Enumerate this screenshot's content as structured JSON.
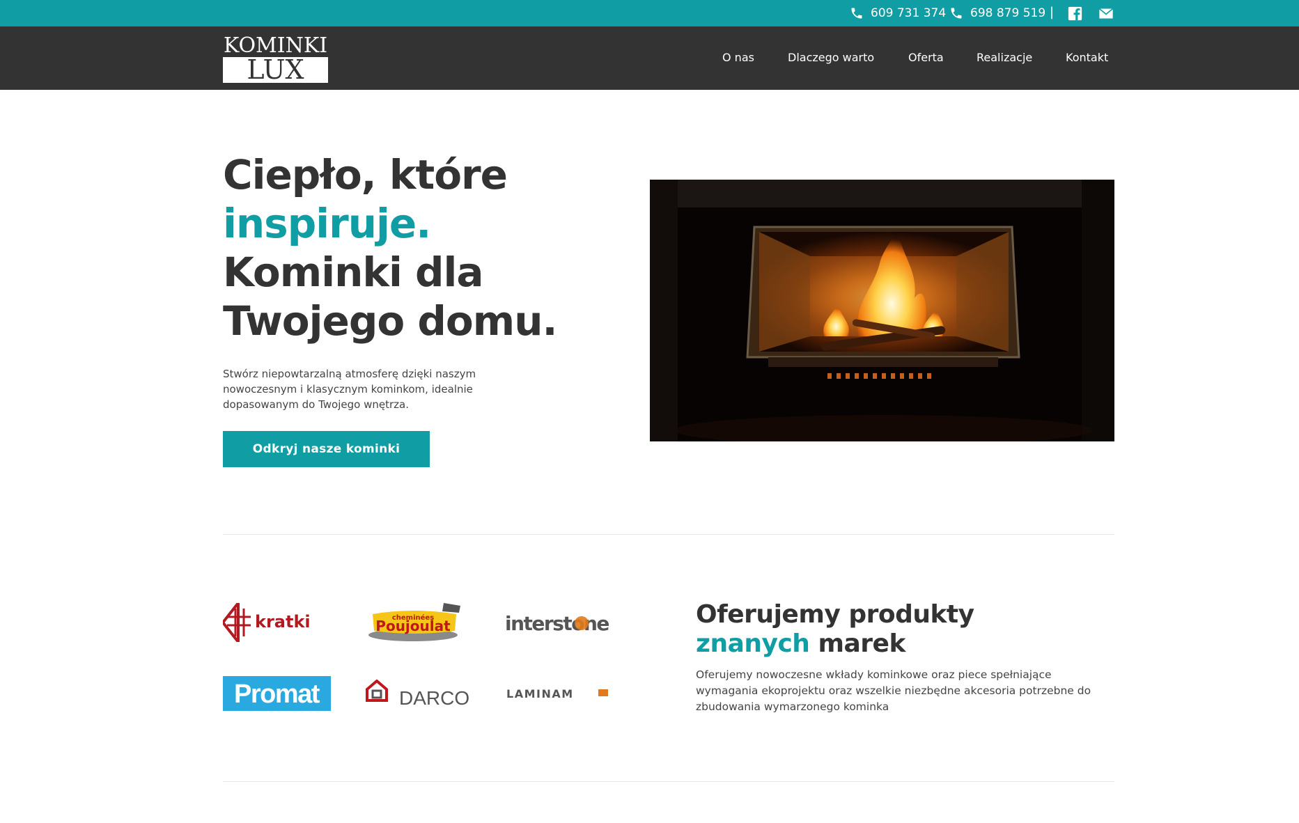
{
  "topbar": {
    "phone1": "609 731 374",
    "phone2": "698 879 519",
    "separator": "|",
    "icons": [
      "phone-icon",
      "facebook-icon",
      "mail-icon"
    ]
  },
  "logo": {
    "line1": "KOMINKI",
    "line2": "LUX"
  },
  "nav": {
    "items": [
      "O nas",
      "Dlaczego warto",
      "Oferta",
      "Realizacje",
      "Kontakt"
    ]
  },
  "hero": {
    "title_line1": "Ciepło, które",
    "title_accent": "inspiruje.",
    "title_line3": "Kominki dla",
    "title_line4": "Twojego domu.",
    "text": "Stwórz niepowtarzalną atmosferę dzięki naszym nowoczesnym i klasycznym kominkom, idealnie dopasowanym do Twojego wnętrza.",
    "button": "Odkryj nasze kominki"
  },
  "brands": {
    "title_line1": "Oferujemy produkty",
    "title_accent": "znanych",
    "title_rest": " marek",
    "text": "Oferujemy nowoczesne wkłady kominkowe oraz piece spełniające wymagania ekoprojektu oraz wszelkie niezbędne akcesoria potrzebne do zbudowania wymarzonego kominka",
    "logos": {
      "kratki": "kratki",
      "poujoulat_top": "cheminées",
      "poujoulat": "Poujoulat",
      "interstone": "interstone",
      "promat": "Promat",
      "darco": "DARCO",
      "laminam": "LAMINAM"
    }
  },
  "colors": {
    "accent": "#109da4",
    "dark": "#333333",
    "white": "#ffffff"
  }
}
